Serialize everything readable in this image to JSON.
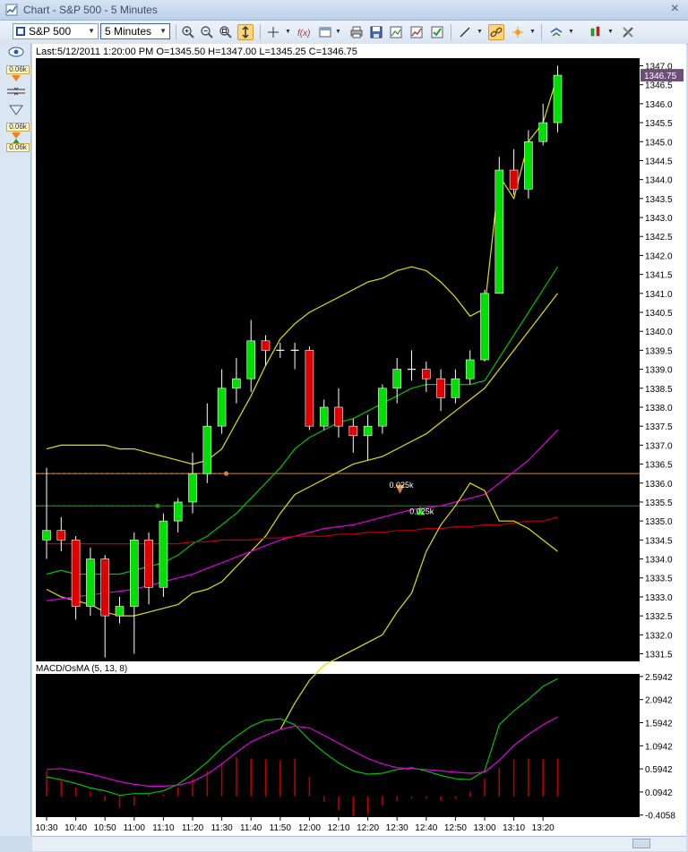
{
  "window": {
    "title": "Chart - S&P 500 - 5 Minutes",
    "close_glyph": "×"
  },
  "toolbar": {
    "symbol": "S&P 500",
    "interval": "5 Minutes",
    "icons": [
      "zoom-in-icon",
      "zoom-out-icon",
      "zoom-fit-icon",
      "autoscale-icon",
      "crosshair-icon",
      "indicator-icon",
      "template-icon",
      "print-icon",
      "save-icon",
      "copy-image-icon",
      "chart-icon",
      "chart-check-icon",
      "line-tool-icon",
      "link-icon",
      "studies-icon",
      "cursor-icon",
      "bars-icon",
      "settings-icon"
    ]
  },
  "sidebar": {
    "badges": [
      "0.06k",
      "0.06k",
      "0.06k"
    ]
  },
  "colors": {
    "background": "#000000",
    "up": "#00e000",
    "down": "#e00000",
    "yellow": "#e0e000",
    "magenta": "#e000e0",
    "green": "#00c000",
    "red": "#c00000",
    "orange": "#e08030",
    "hline_green": "#10a010",
    "grid": "#ffffff"
  },
  "chart_data": [
    {
      "type": "candlestick",
      "info": "Last:5/12/2011 1:20:00 PM O=1345.50 H=1347.00 L=1345.25 C=1346.75",
      "last_price_label": "1346.75",
      "ylim": [
        1331.3,
        1347.2
      ],
      "yticks": [
        1347.0,
        1346.5,
        1346.0,
        1345.5,
        1345.0,
        1344.5,
        1344.0,
        1343.5,
        1343.0,
        1342.5,
        1342.0,
        1341.5,
        1341.0,
        1340.5,
        1340.0,
        1339.5,
        1339.0,
        1338.5,
        1338.0,
        1337.5,
        1337.0,
        1336.5,
        1336.0,
        1335.5,
        1335.0,
        1334.5,
        1334.0,
        1333.5,
        1333.0,
        1332.5,
        1332.0,
        1331.5
      ],
      "yticks_label": [
        "1347.0",
        "1346.5",
        "1346.0",
        "1345.5",
        "1345.0",
        "1344.5",
        "1344.0",
        "1343.5",
        "1343.0",
        "1342.5",
        "1342.0",
        "1341.5",
        "1341.0",
        "1340.5",
        "1340.0",
        "1339.5",
        "1339.0",
        "1338.5",
        "1338.0",
        "1337.5",
        "1337.0",
        "1336.5",
        "1336.0",
        "1335.5",
        "1335.0",
        "1334.5",
        "1334.0",
        "1333.5",
        "1333.0",
        "1332.5",
        "1332.0",
        "1331.5"
      ],
      "candles": [
        {
          "o": 1334.5,
          "h": 1336.4,
          "l": 1334.0,
          "c": 1334.75
        },
        {
          "o": 1334.75,
          "h": 1335.1,
          "l": 1334.2,
          "c": 1334.5
        },
        {
          "o": 1334.5,
          "h": 1334.6,
          "l": 1332.4,
          "c": 1332.75
        },
        {
          "o": 1332.75,
          "h": 1334.3,
          "l": 1332.5,
          "c": 1334.0
        },
        {
          "o": 1334.0,
          "h": 1334.1,
          "l": 1331.4,
          "c": 1332.5
        },
        {
          "o": 1332.5,
          "h": 1333.0,
          "l": 1332.3,
          "c": 1332.75
        },
        {
          "o": 1332.75,
          "h": 1334.7,
          "l": 1331.5,
          "c": 1334.5
        },
        {
          "o": 1334.5,
          "h": 1334.7,
          "l": 1332.8,
          "c": 1333.25
        },
        {
          "o": 1333.25,
          "h": 1335.2,
          "l": 1333.0,
          "c": 1335.0
        },
        {
          "o": 1335.0,
          "h": 1335.6,
          "l": 1334.7,
          "c": 1335.5
        },
        {
          "o": 1335.5,
          "h": 1336.8,
          "l": 1335.2,
          "c": 1336.25
        },
        {
          "o": 1336.25,
          "h": 1338.1,
          "l": 1336.0,
          "c": 1337.5
        },
        {
          "o": 1337.5,
          "h": 1339.0,
          "l": 1337.3,
          "c": 1338.5
        },
        {
          "o": 1338.5,
          "h": 1339.3,
          "l": 1338.1,
          "c": 1338.75
        },
        {
          "o": 1338.75,
          "h": 1340.3,
          "l": 1338.4,
          "c": 1339.75
        },
        {
          "o": 1339.75,
          "h": 1339.9,
          "l": 1339.1,
          "c": 1339.5
        },
        {
          "o": 1339.5,
          "h": 1339.7,
          "l": 1339.3,
          "c": 1339.5
        },
        {
          "o": 1339.5,
          "h": 1339.7,
          "l": 1339.0,
          "c": 1339.5
        },
        {
          "o": 1339.5,
          "h": 1339.6,
          "l": 1337.4,
          "c": 1337.5
        },
        {
          "o": 1337.5,
          "h": 1338.2,
          "l": 1337.4,
          "c": 1338.0
        },
        {
          "o": 1338.0,
          "h": 1338.5,
          "l": 1337.2,
          "c": 1337.5
        },
        {
          "o": 1337.5,
          "h": 1337.7,
          "l": 1336.8,
          "c": 1337.25
        },
        {
          "o": 1337.25,
          "h": 1337.8,
          "l": 1336.6,
          "c": 1337.5
        },
        {
          "o": 1337.5,
          "h": 1338.6,
          "l": 1337.3,
          "c": 1338.5
        },
        {
          "o": 1338.5,
          "h": 1339.3,
          "l": 1338.1,
          "c": 1339.0
        },
        {
          "o": 1339.0,
          "h": 1339.5,
          "l": 1338.7,
          "c": 1339.0
        },
        {
          "o": 1339.0,
          "h": 1339.2,
          "l": 1338.4,
          "c": 1338.75
        },
        {
          "o": 1338.75,
          "h": 1339.0,
          "l": 1337.9,
          "c": 1338.25
        },
        {
          "o": 1338.25,
          "h": 1339.0,
          "l": 1338.1,
          "c": 1338.75
        },
        {
          "o": 1338.75,
          "h": 1339.5,
          "l": 1338.6,
          "c": 1339.25
        },
        {
          "o": 1339.25,
          "h": 1341.1,
          "l": 1339.2,
          "c": 1341.0
        },
        {
          "o": 1341.0,
          "h": 1344.6,
          "l": 1341.0,
          "c": 1344.25
        },
        {
          "o": 1344.25,
          "h": 1344.8,
          "l": 1343.6,
          "c": 1343.75
        },
        {
          "o": 1343.75,
          "h": 1345.3,
          "l": 1343.5,
          "c": 1345.0
        },
        {
          "o": 1345.0,
          "h": 1346.0,
          "l": 1344.9,
          "c": 1345.5
        },
        {
          "o": 1345.5,
          "h": 1347.0,
          "l": 1345.25,
          "c": 1346.75
        }
      ],
      "lines": [
        {
          "role": "bollinger-upper",
          "color": "#e0e000",
          "values": [
            1336.9,
            1337.0,
            1337.0,
            1337.0,
            1337.0,
            1336.9,
            1336.9,
            1336.8,
            1336.7,
            1336.6,
            1336.5,
            1336.6,
            1336.9,
            1337.6,
            1338.3,
            1339.1,
            1339.8,
            1340.2,
            1340.5,
            1340.7,
            1340.9,
            1341.1,
            1341.3,
            1341.4,
            1341.6,
            1341.7,
            1341.6,
            1341.3,
            1340.9,
            1340.4,
            1340.6,
            1344.1,
            1343.5,
            1345.0,
            1345.5,
            1346.75
          ]
        },
        {
          "role": "bollinger-lower",
          "color": "#e0e000",
          "values": [
            1333.2,
            1333.0,
            1332.9,
            1332.8,
            1332.6,
            1332.5,
            1332.5,
            1332.6,
            1332.7,
            1332.8,
            1333.1,
            1333.2,
            1333.4,
            1333.8,
            1334.2,
            1334.6,
            1335.2,
            1335.7,
            1335.9,
            1336.1,
            1336.3,
            1336.5,
            1336.6,
            1336.7,
            1336.9,
            1337.1,
            1337.3,
            1337.6,
            1337.9,
            1338.2,
            1338.5,
            1339.0,
            1339.5,
            1340.0,
            1340.5,
            1341.0
          ]
        },
        {
          "role": "ema-fast",
          "color": "#00c000",
          "values": [
            1333.6,
            1333.7,
            1333.6,
            1333.6,
            1333.6,
            1333.6,
            1333.7,
            1333.8,
            1333.9,
            1334.1,
            1334.4,
            1334.6,
            1334.9,
            1335.2,
            1335.6,
            1336.0,
            1336.4,
            1336.9,
            1337.2,
            1337.4,
            1337.6,
            1337.7,
            1337.9,
            1338.1,
            1338.3,
            1338.5,
            1338.6,
            1338.6,
            1338.6,
            1338.6,
            1338.7,
            1339.3,
            1339.9,
            1340.5,
            1341.1,
            1341.7
          ]
        },
        {
          "role": "sma-slow",
          "color": "#e000e0",
          "values": [
            1332.9,
            1332.95,
            1333.0,
            1333.05,
            1333.1,
            1333.15,
            1333.2,
            1333.3,
            1333.4,
            1333.5,
            1333.6,
            1333.75,
            1333.9,
            1334.05,
            1334.2,
            1334.35,
            1334.5,
            1334.6,
            1334.7,
            1334.8,
            1334.85,
            1334.9,
            1335.0,
            1335.1,
            1335.2,
            1335.3,
            1335.35,
            1335.4,
            1335.5,
            1335.6,
            1335.7,
            1336.0,
            1336.3,
            1336.6,
            1337.0,
            1337.4
          ]
        },
        {
          "role": "sma-long",
          "color": "#c00000",
          "values": [
            1334.4,
            1334.4,
            1334.4,
            1334.4,
            1334.4,
            1334.4,
            1334.4,
            1334.4,
            1334.4,
            1334.4,
            1334.45,
            1334.45,
            1334.5,
            1334.5,
            1334.5,
            1334.55,
            1334.55,
            1334.6,
            1334.6,
            1334.6,
            1334.65,
            1334.65,
            1334.7,
            1334.7,
            1334.75,
            1334.75,
            1334.8,
            1334.8,
            1334.85,
            1334.85,
            1334.9,
            1334.9,
            1334.95,
            1335.0,
            1335.0,
            1335.1
          ]
        },
        {
          "role": "oscillator",
          "color": "#e0e000",
          "start": 16,
          "values": [
            null,
            null,
            null,
            null,
            null,
            null,
            null,
            null,
            null,
            null,
            null,
            null,
            null,
            null,
            null,
            null,
            1329.5,
            1330.2,
            1330.8,
            1331.2,
            1331.4,
            1331.6,
            1331.8,
            1332.0,
            1332.6,
            1333.1,
            1334.2,
            1334.9,
            1335.4,
            1336.0,
            1335.8,
            1335.0,
            1335.0,
            1334.8,
            1334.5,
            1334.2
          ]
        }
      ],
      "hlines": [
        {
          "role": "orange",
          "value": 1336.25,
          "color": "#e08030"
        },
        {
          "role": "green",
          "value": 1335.4,
          "color": "#10a010"
        }
      ],
      "markers": [
        {
          "label": "0.025k",
          "value": 1336.0,
          "index": 24.2,
          "shape": "down",
          "color": "#e08030"
        },
        {
          "label": "0.025k",
          "value": 1335.3,
          "index": 25.6,
          "shape": "up",
          "color": "#00c000"
        }
      ]
    },
    {
      "type": "macd",
      "title": "MACD/OsMA (5, 13, 8)",
      "ylim": [
        -0.45,
        2.65
      ],
      "yticks": [
        2.5942,
        2.0942,
        1.5942,
        1.0942,
        0.5942,
        0.0942,
        -0.4058
      ],
      "yticks_label": [
        "2.5942",
        "2.0942",
        "1.5942",
        "1.0942",
        "0.5942",
        "0.0942",
        "-0.4058"
      ],
      "macd": [
        0.42,
        0.36,
        0.28,
        0.18,
        0.12,
        0.02,
        0.06,
        0.06,
        0.12,
        0.26,
        0.48,
        0.74,
        1.05,
        1.3,
        1.52,
        1.65,
        1.68,
        1.55,
        1.22,
        0.95,
        0.72,
        0.55,
        0.48,
        0.5,
        0.58,
        0.62,
        0.55,
        0.45,
        0.38,
        0.36,
        0.55,
        1.55,
        1.85,
        2.1,
        2.38,
        2.55
      ],
      "signal": [
        0.58,
        0.6,
        0.55,
        0.48,
        0.4,
        0.32,
        0.26,
        0.22,
        0.22,
        0.24,
        0.32,
        0.48,
        0.7,
        0.95,
        1.18,
        1.32,
        1.45,
        1.52,
        1.48,
        1.32,
        1.15,
        0.98,
        0.82,
        0.7,
        0.62,
        0.6,
        0.58,
        0.55,
        0.52,
        0.5,
        0.52,
        0.78,
        1.1,
        1.34,
        1.55,
        1.72
      ],
      "histogram": [
        0.55,
        0.35,
        0.2,
        0.1,
        -0.1,
        -0.25,
        -0.2,
        0.05,
        0.05,
        0.2,
        0.38,
        0.55,
        0.72,
        0.85,
        0.82,
        0.8,
        0.78,
        0.82,
        0.42,
        -0.12,
        -0.3,
        -0.42,
        -0.38,
        -0.2,
        -0.1,
        -0.05,
        -0.05,
        -0.1,
        -0.05,
        0.1,
        0.38,
        0.62,
        0.8,
        0.82,
        0.8,
        0.82
      ]
    }
  ],
  "time_axis": {
    "labels": [
      "10:30",
      "10:40",
      "10:50",
      "11:00",
      "11:10",
      "11:20",
      "11:30",
      "11:40",
      "11:50",
      "12:00",
      "12:10",
      "12:20",
      "12:30",
      "12:40",
      "12:50",
      "13:00",
      "13:10",
      "13:20"
    ]
  }
}
